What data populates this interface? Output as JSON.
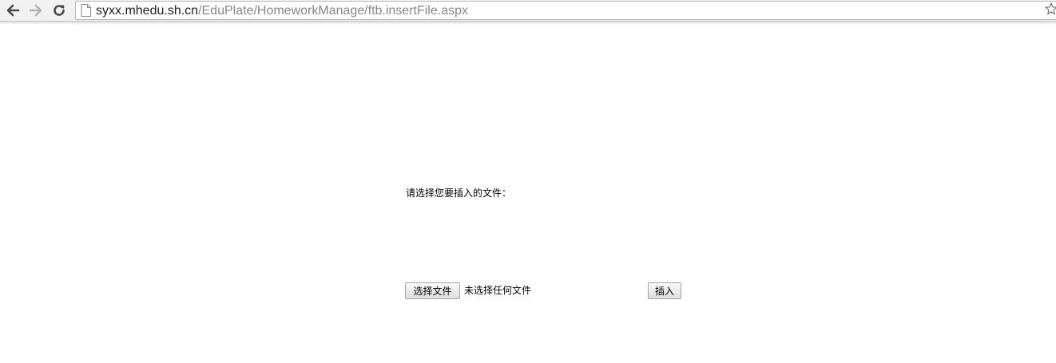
{
  "browser": {
    "url_host": "syxx.mhedu.sh.cn",
    "url_path": "/EduPlate/HomeworkManage/ftb.insertFile.aspx",
    "icons": [
      "back-arrow-icon",
      "forward-arrow-icon",
      "reload-icon",
      "page-icon",
      "bookmark-star-icon"
    ]
  },
  "form": {
    "prompt": "请选择您要插入的文件：",
    "choose_file_label": "选择文件",
    "file_status": "未选择任何文件",
    "insert_label": "插入"
  }
}
